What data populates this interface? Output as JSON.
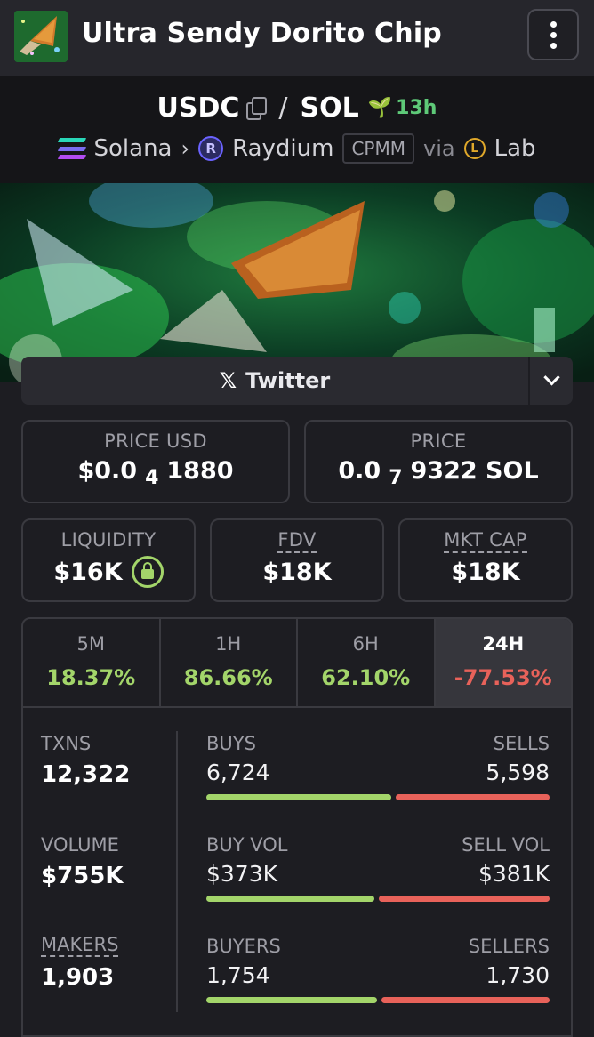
{
  "header": {
    "title": "Ultra Sendy Dorito Chip",
    "logo_icon": "dorito-chip-logo",
    "menu_icon": "vertical-dots-icon"
  },
  "pair": {
    "base": "USDC",
    "quote": "SOL",
    "separator": "/",
    "age": "13h",
    "chain": "Solana",
    "dex": "Raydium",
    "pool_type": "CPMM",
    "via_label": "via",
    "via_name": "Lab"
  },
  "links": {
    "twitter_label": "Twitter",
    "twitter_icon": "x-logo-icon"
  },
  "prices": {
    "usd_label": "PRICE USD",
    "usd_prefix": "$0.0",
    "usd_sub": "4",
    "usd_suffix": "1880",
    "native_label": "PRICE",
    "native_prefix": "0.0",
    "native_sub": "7",
    "native_suffix": "9322 SOL"
  },
  "metrics": {
    "liquidity_label": "LIQUIDITY",
    "liquidity_value": "$16K",
    "fdv_label": "FDV",
    "fdv_value": "$18K",
    "mktcap_label": "MKT CAP",
    "mktcap_value": "$18K"
  },
  "timeframes": [
    {
      "label": "5M",
      "value": "18.37%",
      "trend": "pos"
    },
    {
      "label": "1H",
      "value": "86.66%",
      "trend": "pos"
    },
    {
      "label": "6H",
      "value": "62.10%",
      "trend": "pos"
    },
    {
      "label": "24H",
      "value": "-77.53%",
      "trend": "neg",
      "active": true
    }
  ],
  "stats": {
    "txns_label": "TXNS",
    "txns_value": "12,322",
    "volume_label": "VOLUME",
    "volume_value": "$755K",
    "makers_label": "MAKERS",
    "makers_value": "1,903",
    "buys_label": "BUYS",
    "buys_value": "6,724",
    "sells_label": "SELLS",
    "sells_value": "5,598",
    "buys_ratio": 0.546,
    "buy_vol_label": "BUY VOL",
    "buy_vol_value": "$373K",
    "sell_vol_label": "SELL VOL",
    "sell_vol_value": "$381K",
    "buy_vol_ratio": 0.495,
    "buyers_label": "BUYERS",
    "buyers_value": "1,754",
    "sellers_label": "SELLERS",
    "sellers_value": "1,730",
    "buyers_ratio": 0.503
  },
  "colors": {
    "positive": "#a3d56a",
    "negative": "#e8625a",
    "age_green": "#5ec978"
  }
}
